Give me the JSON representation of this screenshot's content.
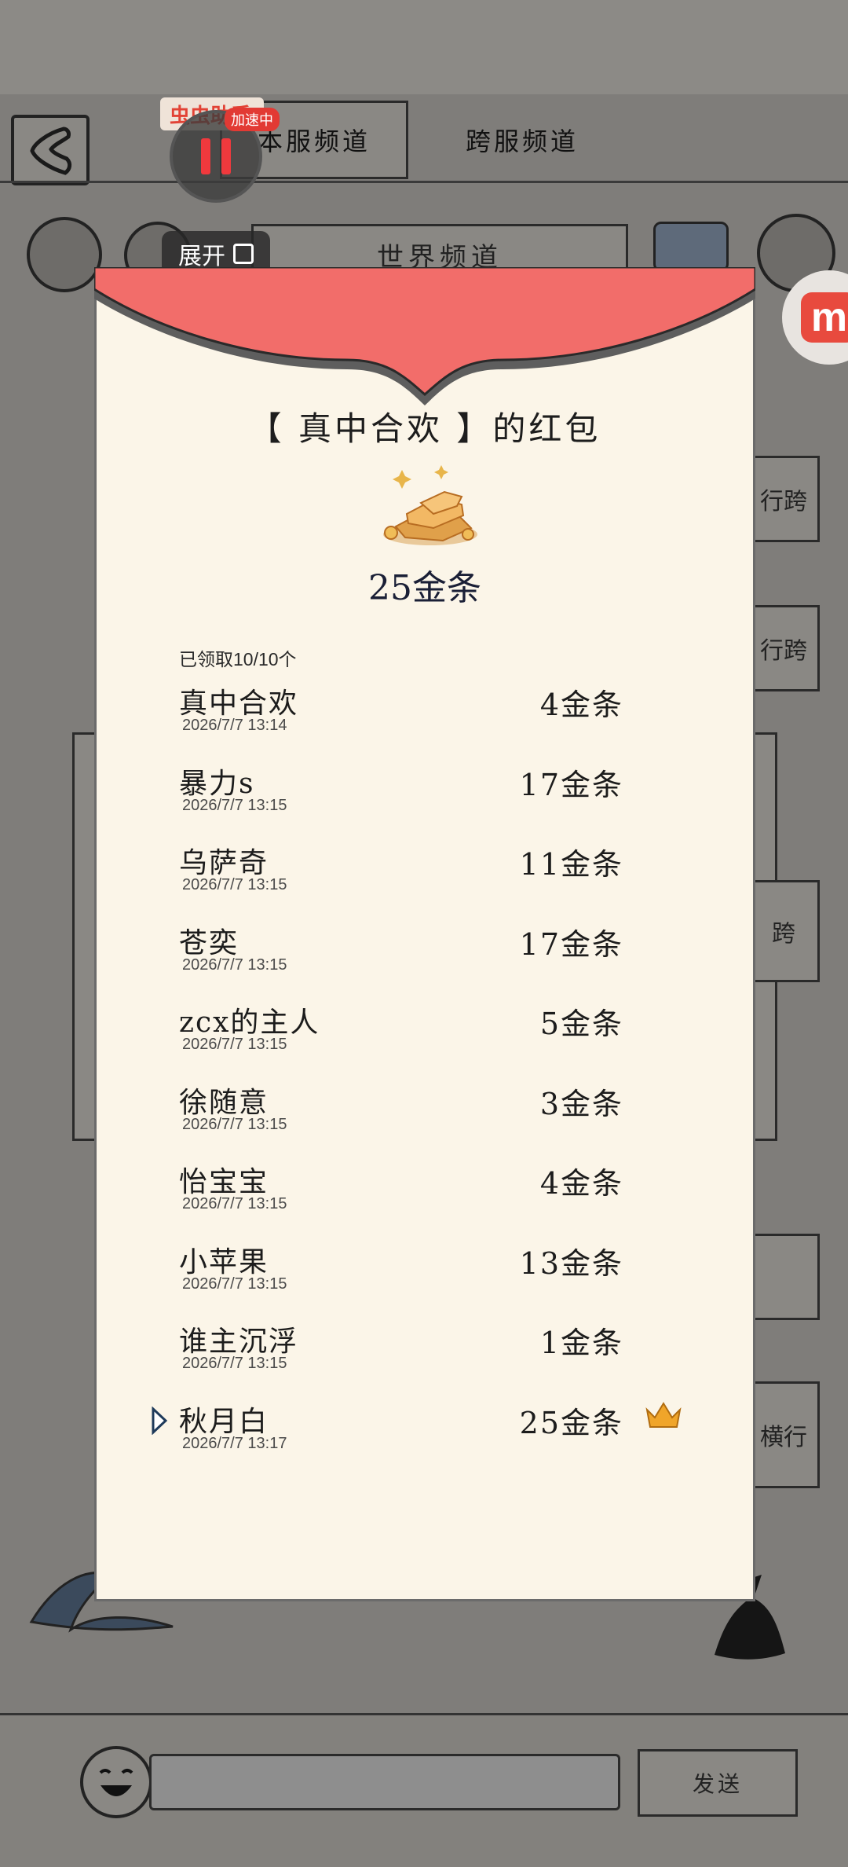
{
  "background": {
    "tabs": {
      "server": "本服频道",
      "cross": "跨服频道"
    },
    "world_channel": "世界频道",
    "side_buttons": [
      "行跨",
      "行跨",
      "跨",
      "横行"
    ],
    "send_label": "发送"
  },
  "overlay": {
    "app_label": "虫虫助手",
    "badge": "加速中",
    "expand_label": "展开"
  },
  "red_packet": {
    "title": "【 真中合欢 】的红包",
    "total_amount": "25金条",
    "claimed_text": "已领取10/10个",
    "records": [
      {
        "name": "真中合欢",
        "time": "2026/7/7 13:14",
        "amount": "4金条"
      },
      {
        "name": "暴力s",
        "time": "2026/7/7 13:15",
        "amount": "17金条"
      },
      {
        "name": "乌萨奇",
        "time": "2026/7/7 13:15",
        "amount": "11金条"
      },
      {
        "name": "苍奕",
        "time": "2026/7/7 13:15",
        "amount": "17金条"
      },
      {
        "name": "zcx的主人",
        "time": "2026/7/7 13:15",
        "amount": "5金条"
      },
      {
        "name": "徐随意",
        "time": "2026/7/7 13:15",
        "amount": "3金条"
      },
      {
        "name": "怡宝宝",
        "time": "2026/7/7 13:15",
        "amount": "4金条"
      },
      {
        "name": "小苹果",
        "time": "2026/7/7 13:15",
        "amount": "13金条"
      },
      {
        "name": "谁主沉浮",
        "time": "2026/7/7 13:15",
        "amount": "1金条"
      },
      {
        "name": "秋月白",
        "time": "2026/7/7 13:17",
        "amount": "25金条"
      }
    ]
  },
  "colors": {
    "flap_red": "#f26d6a",
    "modal_bg": "#fbf5e8",
    "crown": "#f0a52a"
  }
}
